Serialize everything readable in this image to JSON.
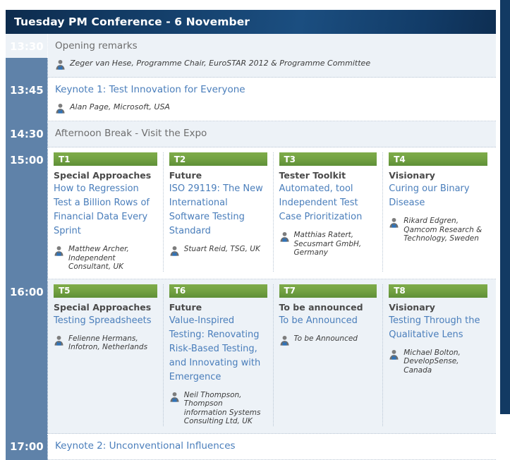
{
  "header": {
    "title": "Tuesday PM Conference - 6 November",
    "bg_color": "#123a63"
  },
  "colors": {
    "time_rail": "#5f82a9",
    "track_header_green": "#74a343",
    "link_blue": "#4a7ebb",
    "row_shade": "#edf2f7"
  },
  "icons": {
    "speaker": "speaker-icon"
  },
  "rows": [
    {
      "time": "13:30",
      "type": "simple",
      "shaded": true,
      "title": "Opening remarks",
      "title_is_link": false,
      "speaker": "Zeger van Hese, Programme Chair, EuroSTAR 2012 & Programme Committee"
    },
    {
      "time": "13:45",
      "type": "simple",
      "shaded": false,
      "title": "Keynote 1: Test Innovation for Everyone",
      "title_is_link": true,
      "speaker": "Alan Page, Microsoft, USA"
    },
    {
      "time": "14:30",
      "type": "simple",
      "shaded": true,
      "title": "Afternoon Break - Visit the Expo",
      "title_is_link": false,
      "speaker": ""
    },
    {
      "time": "15:00",
      "type": "tracks",
      "shaded": false,
      "tracks": [
        {
          "code": "T1",
          "theme": "Special Approaches",
          "title": "How to Regression Test a Billion Rows of Financial Data Every Sprint",
          "speaker": "Matthew Archer, Independent Consultant, UK"
        },
        {
          "code": "T2",
          "theme": "Future",
          "title": "ISO 29119: The New International Software Testing Standard",
          "speaker": "Stuart Reid, TSG, UK"
        },
        {
          "code": "T3",
          "theme": "Tester Toolkit",
          "title": "Automated, tool Independent Test Case Prioritization",
          "speaker": "Matthias Ratert, Secusmart GmbH, Germany"
        },
        {
          "code": "T4",
          "theme": "Visionary",
          "title": "Curing our Binary Disease",
          "speaker": "Rikard Edgren, Qamcom Research & Technology, Sweden"
        }
      ]
    },
    {
      "time": "16:00",
      "type": "tracks",
      "shaded": true,
      "tracks": [
        {
          "code": "T5",
          "theme": "Special Approaches",
          "title": "Testing Spreadsheets",
          "speaker": "Felienne Hermans, Infotron, Netherlands"
        },
        {
          "code": "T6",
          "theme": "Future",
          "title": "Value-Inspired Testing: Renovating Risk-Based Testing, and Innovating with Emergence",
          "speaker": "Neil Thompson, Thompson information Systems Consulting Ltd, UK"
        },
        {
          "code": "T7",
          "theme": "To be announced",
          "title": "To be Announced",
          "speaker": "To be Announced"
        },
        {
          "code": "T8",
          "theme": "Visionary",
          "title": "Testing Through the Qualitative Lens",
          "speaker": "Michael Bolton, DevelopSense, Canada"
        }
      ]
    },
    {
      "time": "17:00",
      "type": "simple",
      "shaded": false,
      "title": "Keynote 2: Unconventional Influences",
      "title_is_link": true,
      "speaker": ""
    }
  ]
}
